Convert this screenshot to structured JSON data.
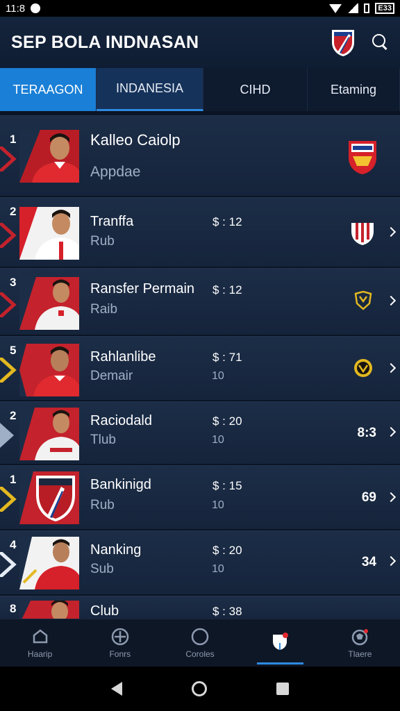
{
  "status_bar": {
    "time": "11:8",
    "battery": "E33"
  },
  "header": {
    "title": "SEP BOLA INDNASAN"
  },
  "tabs": [
    {
      "label": "TERAAGON"
    },
    {
      "label": "INDANESIA"
    },
    {
      "label": "CIHD"
    },
    {
      "label": "Etaming"
    }
  ],
  "rows": [
    {
      "rank": "1",
      "name": "Kalleo Caiolp",
      "sub": "Appdae",
      "price": "",
      "extra": "",
      "score": ""
    },
    {
      "rank": "2",
      "name": "Tranffa",
      "sub": "Rub",
      "price": "$ : 12",
      "extra": "",
      "score": ""
    },
    {
      "rank": "3",
      "name": "Ransfer Permain",
      "sub": "Raib",
      "price": "$ : 12",
      "extra": "",
      "score": ""
    },
    {
      "rank": "5",
      "name": "Rahlanlibe",
      "sub": "Demair",
      "price": "$ : 71",
      "extra": "10",
      "score": ""
    },
    {
      "rank": "2",
      "name": "Raciodald",
      "sub": "Tlub",
      "price": "$ : 20",
      "extra": "10",
      "score": "8:3"
    },
    {
      "rank": "1",
      "name": "Bankinigd",
      "sub": "Rub",
      "price": "$ : 15",
      "extra": "10",
      "score": "69"
    },
    {
      "rank": "4",
      "name": "Nanking",
      "sub": "Sub",
      "price": "$ : 20",
      "extra": "10",
      "score": "34"
    },
    {
      "rank": "8",
      "name": "Club",
      "sub": "",
      "price": "$ : 38",
      "extra": "",
      "score": ""
    }
  ],
  "bottom_nav": [
    {
      "label": "Haarip"
    },
    {
      "label": "Fonrs"
    },
    {
      "label": "Coroles"
    },
    {
      "label": ""
    },
    {
      "label": "Tlaere"
    }
  ],
  "colors": {
    "accent": "#1a7fd6",
    "jersey": "#d6202a",
    "background": "#0b1424"
  }
}
